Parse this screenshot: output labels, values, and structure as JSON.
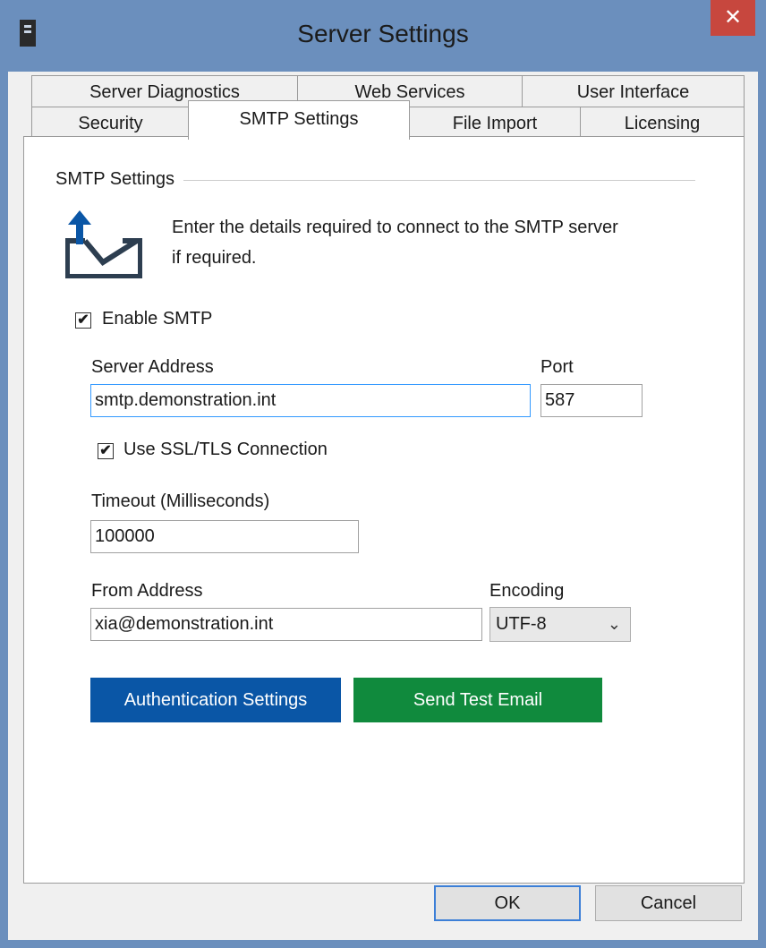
{
  "window": {
    "title": "Server Settings",
    "close_glyph": "✕"
  },
  "tabs": {
    "row1": [
      "Server Diagnostics",
      "Web Services",
      "User Interface"
    ],
    "row2": [
      "Security",
      "SMTP Settings",
      "File Import",
      "Licensing"
    ],
    "active": "SMTP Settings"
  },
  "smtp": {
    "group_title": "SMTP Settings",
    "icon": "mail-upload-icon",
    "description_line1": "Enter the details required to connect to the SMTP server",
    "description_line2": "if required.",
    "enable": {
      "label": "Enable SMTP",
      "checked": true,
      "check_glyph": "✔"
    },
    "server_address": {
      "label": "Server Address",
      "value": "smtp.demonstration.int"
    },
    "port": {
      "label": "Port",
      "value": "587"
    },
    "ssl": {
      "label": "Use SSL/TLS Connection",
      "checked": true,
      "check_glyph": "✔"
    },
    "timeout": {
      "label": "Timeout (Milliseconds)",
      "value": "100000"
    },
    "from_address": {
      "label": "From Address",
      "value": "xia@demonstration.int"
    },
    "encoding": {
      "label": "Encoding",
      "value": "UTF-8",
      "chevron_glyph": "⌄"
    },
    "auth_button": "Authentication Settings",
    "test_button": "Send Test Email"
  },
  "footer": {
    "ok": "OK",
    "cancel": "Cancel"
  },
  "colors": {
    "titlebar": "#6b8fbd",
    "close": "#c7473e",
    "auth_button": "#0a56a6",
    "test_button": "#108a3d",
    "icon": "#2d3e50",
    "arrow": "#0a56a6"
  }
}
